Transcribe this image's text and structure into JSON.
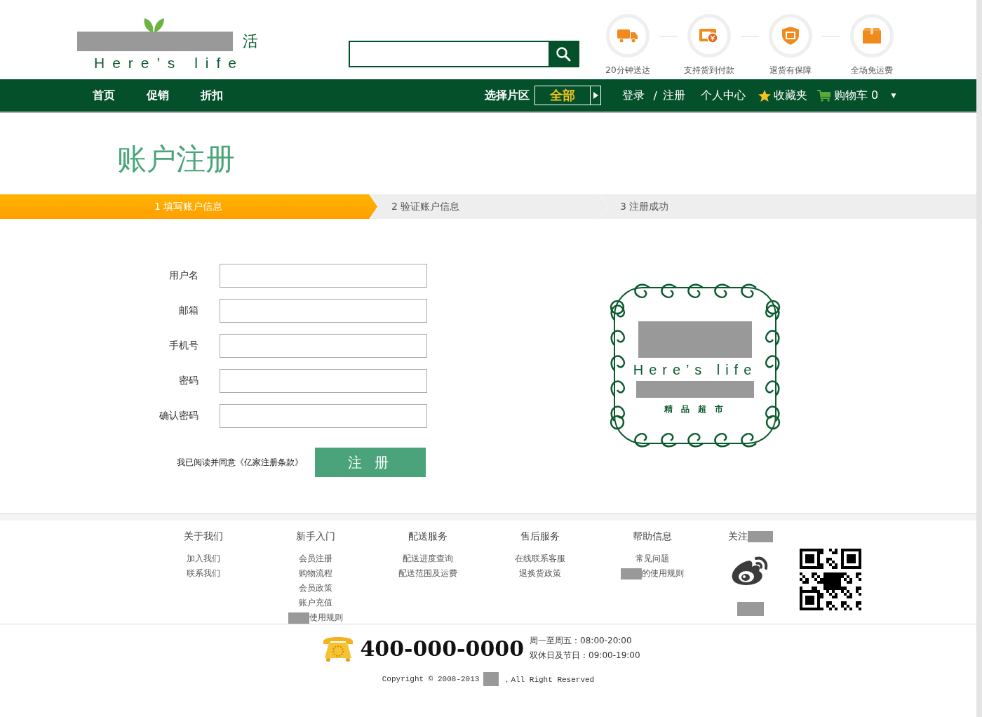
{
  "header": {
    "logo": {
      "visible_text": "活",
      "tagline": "Here’s life",
      "redacted": true
    },
    "features": [
      {
        "kind": "truck",
        "label": "20分钟送达"
      },
      {
        "kind": "wallet",
        "label": "支持货到付款"
      },
      {
        "kind": "shield",
        "label": "退货有保障"
      },
      {
        "kind": "box",
        "label": "全场免运费"
      }
    ]
  },
  "nav": {
    "links": [
      "首页",
      "促销",
      "折扣"
    ],
    "region_label": "选择片区",
    "region_value": "全部",
    "login": "登录",
    "separator": "/",
    "register": "注册",
    "account": "个人中心",
    "favorites": "收藏夹",
    "cart": "购物车 0",
    "cart_menu": "▼"
  },
  "page_title": "账户注册",
  "steps": [
    {
      "label": "1 填写账户信息",
      "selected": true
    },
    {
      "label": "2 验证账户信息",
      "selected": false
    },
    {
      "label": "3 注册成功",
      "selected": false
    }
  ],
  "form": {
    "fields": [
      {
        "label": "用户名"
      },
      {
        "label": "邮箱"
      },
      {
        "label": "手机号"
      },
      {
        "label": "密码"
      },
      {
        "label": "确认密码"
      }
    ],
    "agreement": "我已阅读并同意《亿家注册条款》",
    "submit": "注 册"
  },
  "emblem": {
    "tagline": "Here’s life",
    "subtitle": "精 品 超 市"
  },
  "footer": {
    "columns": [
      {
        "heading": "关于我们",
        "links": [
          {
            "text": "加入我们",
            "redacted_prefix": false
          },
          {
            "text": "联系我们",
            "redacted_prefix": false
          }
        ]
      },
      {
        "heading": "新手入门",
        "links": [
          {
            "text": "会员注册",
            "redacted_prefix": false
          },
          {
            "text": "购物流程",
            "redacted_prefix": false
          },
          {
            "text": "会员政策",
            "redacted_prefix": false
          },
          {
            "text": "账户充值",
            "redacted_prefix": false
          },
          {
            "text": "使用规则",
            "redacted_prefix": true
          }
        ]
      },
      {
        "heading": "配送服务",
        "links": [
          {
            "text": "配送进度查询",
            "redacted_prefix": false
          },
          {
            "text": "配送范围及运费",
            "redacted_prefix": false
          }
        ]
      },
      {
        "heading": "售后服务",
        "links": [
          {
            "text": "在线联系客服",
            "redacted_prefix": false
          },
          {
            "text": "退换货政策",
            "redacted_prefix": false
          }
        ]
      },
      {
        "heading": "帮助信息",
        "links": [
          {
            "text": "常见问题",
            "redacted_prefix": false
          },
          {
            "text": "的使用规则",
            "redacted_prefix": true
          }
        ]
      }
    ],
    "follow": {
      "heading": "关注",
      "redacted": true
    },
    "phone": "400-000-0000",
    "hours": [
      "周一至周五：08:00-20:00",
      "双休日及节日：09:00-19:00"
    ],
    "copyright": "Copyright © 2008-2013",
    "rights": "，All Right Reserved"
  }
}
